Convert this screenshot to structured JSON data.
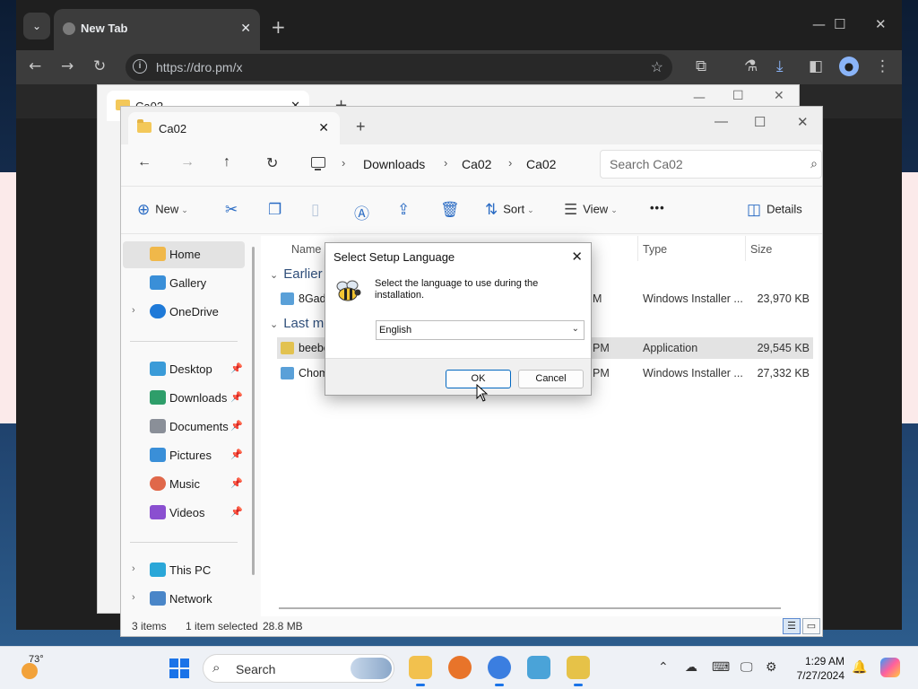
{
  "chrome": {
    "tab_title": "New Tab",
    "url": "https://dro.pm/x",
    "tab_close": "✕",
    "new_tab": "+"
  },
  "explorer_back": {
    "tab_title": "Ca02",
    "tab_close": "✕",
    "new_tab": "+"
  },
  "explorer": {
    "tab_title": "Ca02",
    "tab_close": "✕",
    "new_tab": "+",
    "breadcrumbs": [
      "Downloads",
      "Ca02",
      "Ca02"
    ],
    "search_placeholder": "Search Ca02",
    "commands": {
      "new": "New",
      "sort": "Sort",
      "view": "View",
      "more": "•••",
      "details": "Details"
    },
    "nav": [
      {
        "label": "Home",
        "icon": "home-icon"
      },
      {
        "label": "Gallery",
        "icon": "gallery-icon"
      },
      {
        "label": "OneDrive",
        "icon": "onedrive-icon"
      },
      {
        "label": "Desktop",
        "icon": "desktop-icon"
      },
      {
        "label": "Downloads",
        "icon": "downloads-icon"
      },
      {
        "label": "Documents",
        "icon": "documents-icon"
      },
      {
        "label": "Pictures",
        "icon": "pictures-icon"
      },
      {
        "label": "Music",
        "icon": "music-icon"
      },
      {
        "label": "Videos",
        "icon": "videos-icon"
      },
      {
        "label": "This PC",
        "icon": "this-pc-icon"
      },
      {
        "label": "Network",
        "icon": "network-icon"
      }
    ],
    "columns": [
      "Name",
      "Type",
      "Size"
    ],
    "groups": [
      "Earlier",
      "Last mo"
    ],
    "files": [
      {
        "name": "8Gadg",
        "date": "M",
        "type": "Windows Installer ...",
        "size": "23,970 KB"
      },
      {
        "name": "beebe",
        "date": "PM",
        "type": "Application",
        "size": "29,545 KB"
      },
      {
        "name": "Chom",
        "date": "PM",
        "type": "Windows Installer ...",
        "size": "27,332 KB"
      }
    ],
    "status": {
      "items": "3 items",
      "selected": "1 item selected",
      "size": "28.8 MB"
    }
  },
  "dialog": {
    "title": "Select Setup Language",
    "message": "Select the language to use during the installation.",
    "language": "English",
    "ok": "OK",
    "cancel": "Cancel"
  },
  "taskbar": {
    "temperature": "73°",
    "search": "Search",
    "time": "1:29 AM",
    "date": "7/27/2024"
  }
}
